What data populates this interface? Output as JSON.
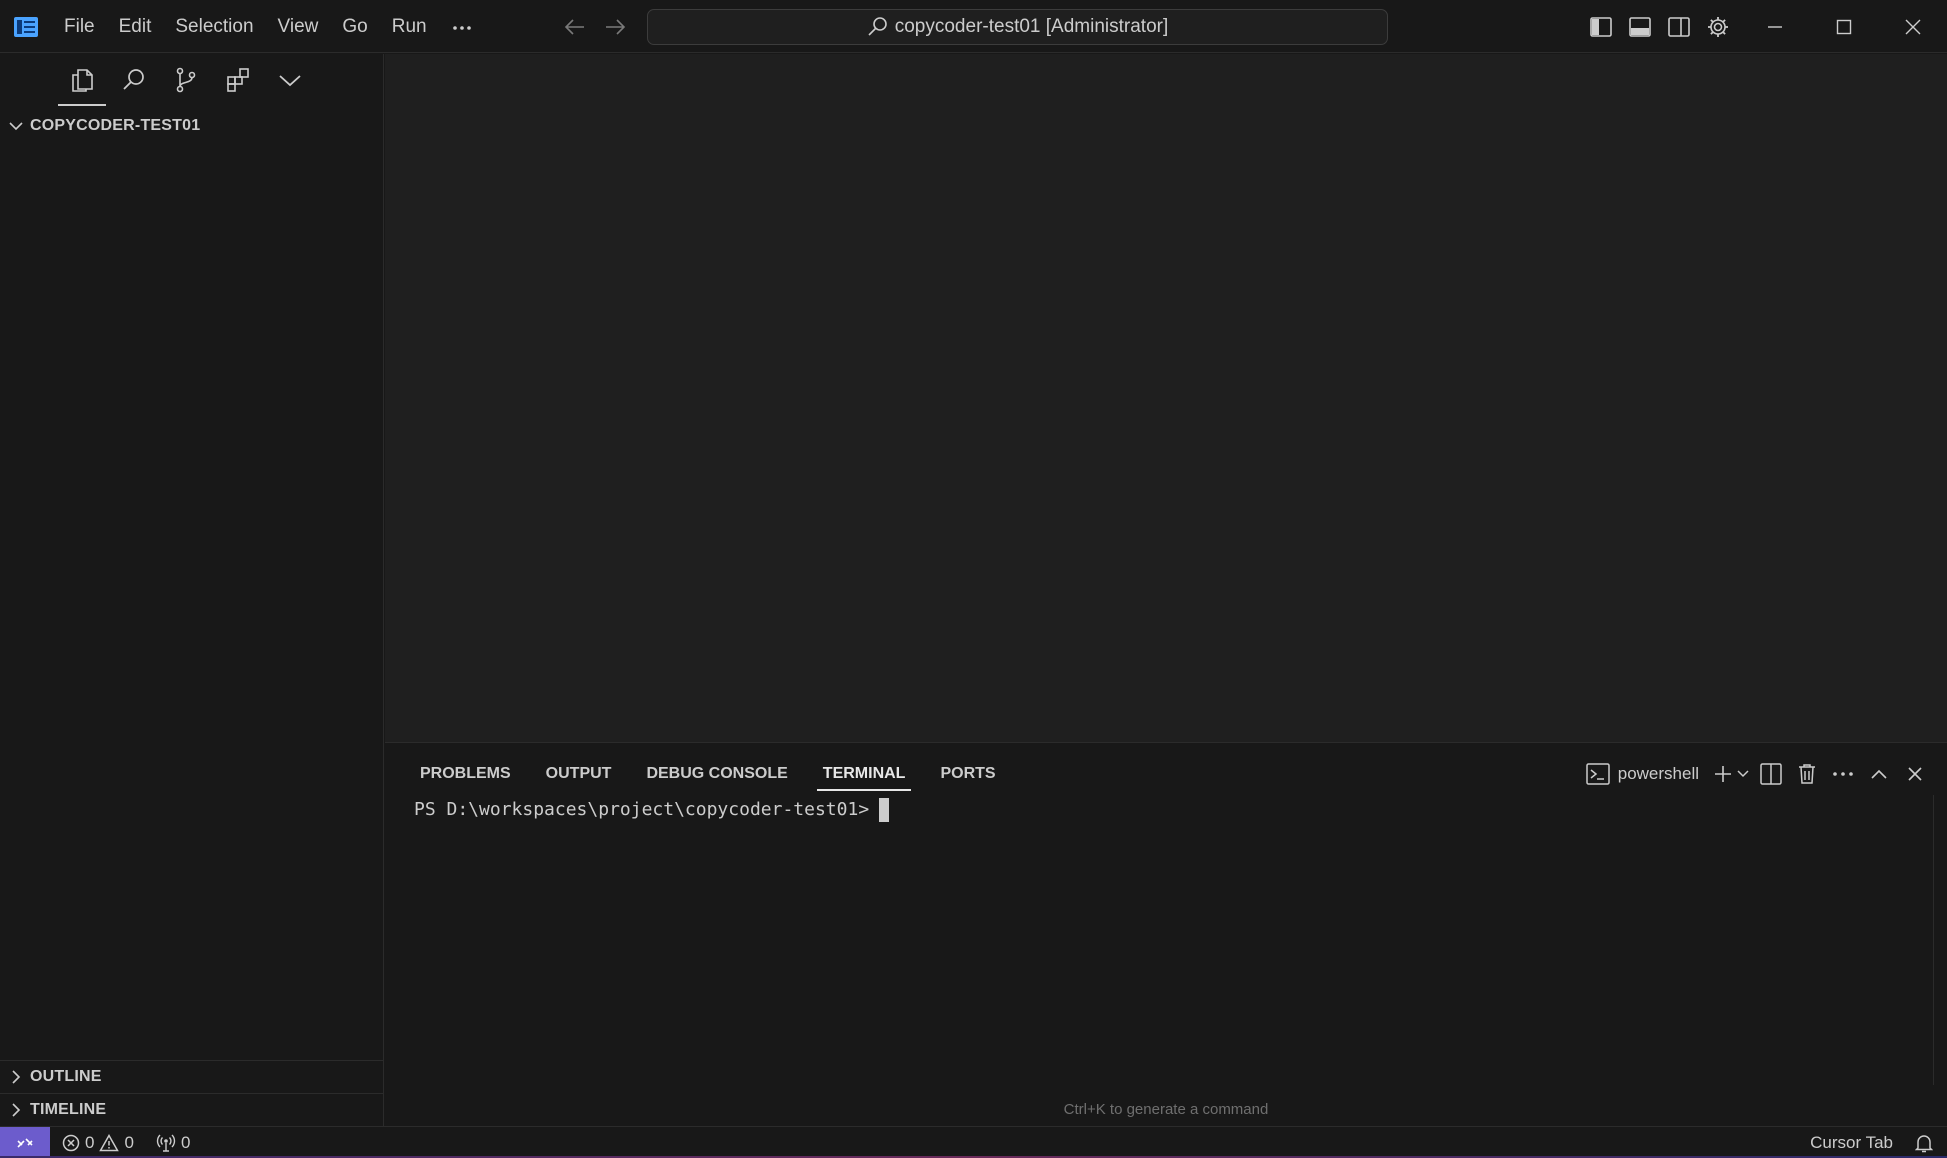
{
  "titlebar": {
    "menu": [
      "File",
      "Edit",
      "Selection",
      "View",
      "Go",
      "Run"
    ],
    "more_icon": "ellipsis-icon",
    "command_center": "copycoder-test01 [Administrator]"
  },
  "sidebar": {
    "activity_tabs": [
      "explorer",
      "search",
      "source-control",
      "extensions"
    ],
    "folder_name": "COPYCODER-TEST01",
    "sections": {
      "outline": "OUTLINE",
      "timeline": "TIMELINE"
    }
  },
  "panel": {
    "tabs": [
      "PROBLEMS",
      "OUTPUT",
      "DEBUG CONSOLE",
      "TERMINAL",
      "PORTS"
    ],
    "active_tab": "TERMINAL",
    "shell": "powershell",
    "terminal_prompt": "PS D:\\workspaces\\project\\copycoder-test01>",
    "hint": "Ctrl+K to generate a command"
  },
  "statusbar": {
    "errors": "0",
    "warnings": "0",
    "ports": "0",
    "cursor_tab": "Cursor Tab"
  },
  "colors": {
    "background": "#181818",
    "editor": "#1f1f1f",
    "remote_accent": "#6c5ccc",
    "foreground": "#cccccc"
  }
}
